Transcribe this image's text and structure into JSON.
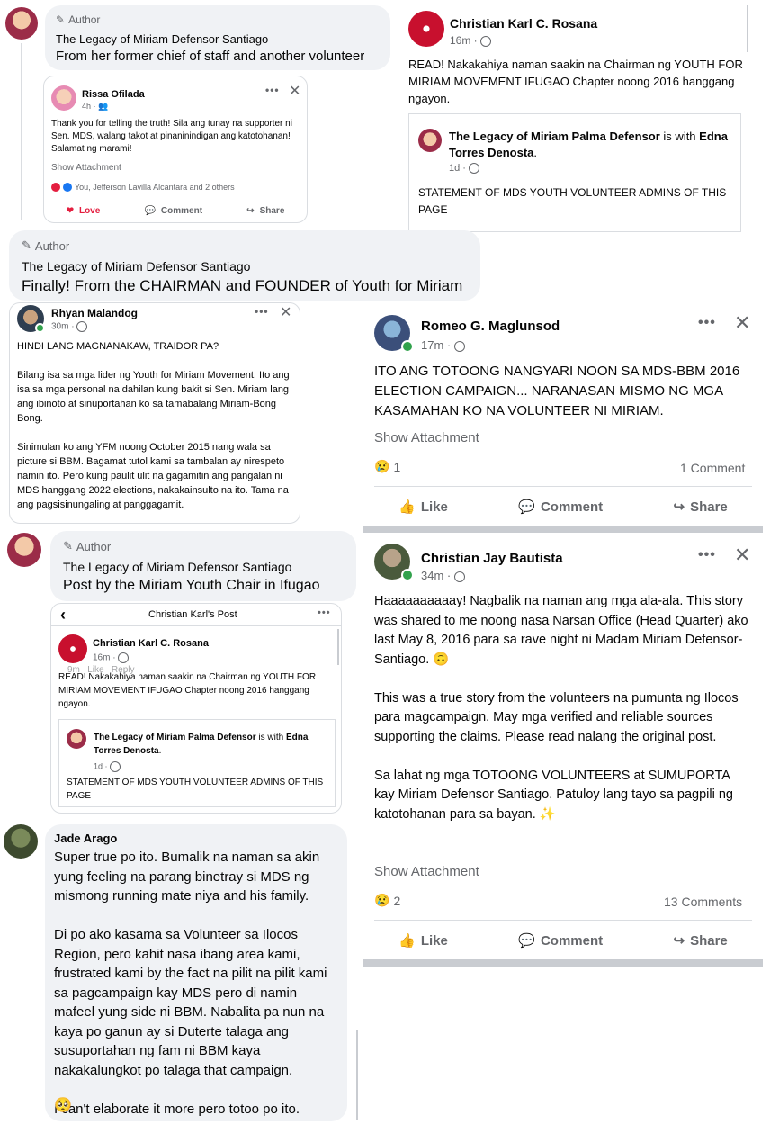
{
  "colors": {
    "bubble_bg": "#f0f2f5",
    "text": "#050505",
    "muted": "#65676b",
    "love": "#e41e3f",
    "online": "#31a24c"
  },
  "b1": {
    "author_label": "Author",
    "name": "The Legacy of Miriam Defensor Santiago",
    "text": "From her former chief of staff and another volunteer"
  },
  "rissa": {
    "name": "Rissa Ofilada",
    "time": "4h",
    "text": "Thank you for telling the truth! Sila ang tunay na supporter ni Sen. MDS, walang takot at pinaninindigan ang katotohanan!  Salamat ng marami!",
    "show_attachment": "Show Attachment",
    "reactions": "You, Jefferson Lavilla Alcantara and 2 others",
    "love": "Love",
    "comment": "Comment",
    "share": "Share"
  },
  "ck1": {
    "name": "Christian Karl C. Rosana",
    "time": "16m",
    "text": "READ! Nakakahiya naman saakin na Chairman ng YOUTH FOR MIRIAM MOVEMENT IFUGAO Chapter noong 2016 hanggang ngayon.",
    "shared_name": "The Legacy of Miriam Palma Defensor",
    "shared_with": "is with",
    "shared_friend": "Edna Torres Denosta",
    "shared_dot": ".",
    "shared_time": "1d",
    "shared_text": "STATEMENT OF MDS YOUTH VOLUNTEER ADMINS OF THIS PAGE"
  },
  "b2": {
    "author_label": "Author",
    "name": "The Legacy of Miriam Defensor Santiago",
    "text": "Finally! From the CHAIRMAN and FOUNDER of Youth for Miriam"
  },
  "rhyan": {
    "name": "Rhyan Malandog",
    "time": "30m",
    "text": "HINDI LANG MAGNANAKAW, TRAIDOR PA?\n\nBilang isa sa mga lider ng Youth for Miriam Movement. Ito ang isa sa mga personal na dahilan kung bakit si Sen. Miriam lang ang ibinoto at sinuportahan ko sa tamabalang Miriam-Bong Bong.\n\nSinimulan ko ang YFM noong October 2015 nang wala sa picture si BBM. Bagamat tutol kami sa tambalan ay nirespeto namin ito. Pero kung paulit ulit na gagamitin ang pangalan ni MDS hanggang 2022 elections, nakakainsulto  na ito. Tama na ang pagsisinungaling at panggagamit."
  },
  "romeo": {
    "name": "Romeo G. Maglunsod",
    "time": "17m",
    "text": "ITO ANG TOTOONG NANGYARI NOON SA MDS-BBM 2016 ELECTION CAMPAIGN... NARANASAN MISMO NG MGA KASAMAHAN KO NA VOLUNTEER NI MIRIAM.",
    "show_attachment": "Show Attachment",
    "reaction_count": "1",
    "comments": "1 Comment",
    "like": "Like",
    "comment": "Comment",
    "share": "Share"
  },
  "b3": {
    "author_label": "Author",
    "name": "The Legacy of Miriam Defensor Santiago",
    "text": "Post by the Miriam Youth Chair in Ifugao"
  },
  "ck2": {
    "header": "Christian Karl's Post",
    "name": "Christian Karl C. Rosana",
    "time": "16m",
    "overlay": "9m   Like   Reply",
    "text": "READ! Nakakahiya naman saakin na Chairman ng YOUTH FOR MIRIAM MOVEMENT IFUGAO Chapter noong 2016 hanggang ngayon.",
    "shared_name": "The Legacy of Miriam Palma Defensor",
    "shared_with": "is with",
    "shared_friend": "Edna Torres Denosta",
    "shared_dot": ".",
    "shared_time": "1d",
    "shared_text": "STATEMENT OF MDS YOUTH VOLUNTEER ADMINS OF THIS PAGE"
  },
  "jay": {
    "name": "Christian Jay Bautista",
    "time": "34m",
    "text": "Haaaaaaaaaay! Nagbalik na naman ang mga ala-ala. This story was shared to me noong nasa Narsan Office (Head Quarter) ako last May 8, 2016 para sa rave night ni Madam Miriam Defensor-Santiago. 🙃\n\nThis was a true story from the volunteers na pumunta ng Ilocos para magcampaign. May mga verified and reliable sources supporting the claims. Please read nalang the original post.\n\nSa lahat ng mga TOTOONG VOLUNTEERS at SUMUPORTA kay Miriam Defensor Santiago. Patuloy lang tayo sa pagpili ng katotohanan para sa bayan. ✨",
    "show_attachment": "Show Attachment",
    "reaction_count": "2",
    "comments": "13 Comments",
    "like": "Like",
    "comment": "Comment",
    "share": "Share"
  },
  "jade": {
    "name": "Jade Arago",
    "text": "Super true po ito. Bumalik na naman sa akin yung feeling na parang binetray si MDS ng mismong running mate niya and his family.\n\nDi po ako kasama sa Volunteer sa Ilocos Region, pero kahit nasa ibang area kami, frustrated kami by the fact na pilit na pilit kami sa pagcampaign kay MDS pero di namin mafeel yung side ni BBM. Nabalita pa nun na kaya po ganun ay si Duterte talaga ang susuportahan ng fam ni BBM kaya nakakalungkot po talaga that campaign.\n\nI can't elaborate it more pero totoo po ito.",
    "emoji": "🥺"
  }
}
